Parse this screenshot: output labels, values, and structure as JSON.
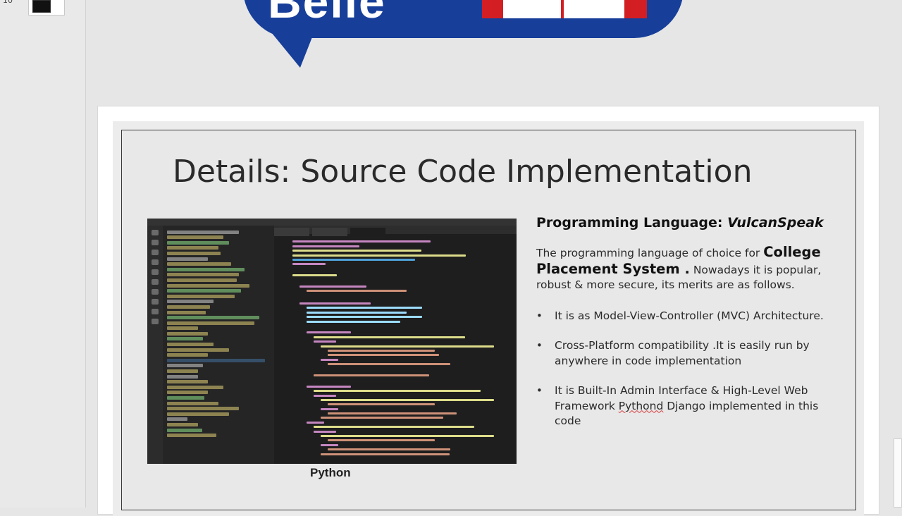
{
  "window": {
    "slide_number": "10"
  },
  "logo": {
    "visible_letters": "Belle",
    "colors": {
      "blue": "#173f9a",
      "red": "#d31f23"
    }
  },
  "slide": {
    "title": "Details: Source Code Implementation",
    "image_caption": "Python",
    "heading_prefix": "Programming Language: ",
    "heading_language": "VulcanSpeak",
    "paragraph": {
      "before": "The programming language of choice for ",
      "emphasis": "College Placement System .",
      "after": " Nowadays it is popular, robust & more secure, its merits are as follows."
    },
    "bullets": [
      {
        "text": "It is as Model-View-Controller (MVC) Architecture."
      },
      {
        "text": "Cross-Platform compatibility .It is easily run by anywhere in code implementation"
      },
      {
        "text_before": "It is Built-In Admin Interface & High-Level Web Framework ",
        "misspelled": "Pythond",
        "text_after": " Django implemented in this code"
      }
    ]
  }
}
